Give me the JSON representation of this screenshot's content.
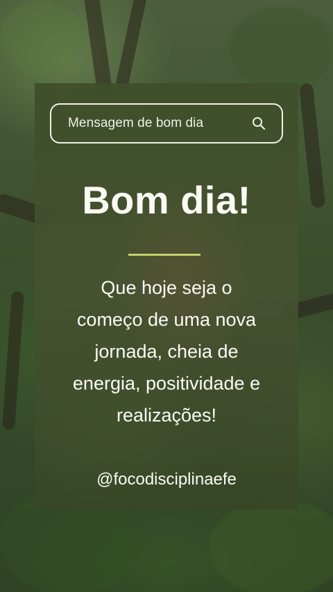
{
  "search": {
    "text": "Mensagem de bom dia",
    "icon": "search-icon"
  },
  "post": {
    "title": "Bom dia!",
    "message_lines": [
      "Que hoje seja o",
      "começo de uma nova",
      "jornada, cheia de",
      "energia, positividade e",
      "realizações!"
    ],
    "handle": "@focodisciplinaefe"
  },
  "colors": {
    "divider": "#c6d16a",
    "text": "#fbfaf3",
    "card_tint": "#3e4e2a"
  }
}
